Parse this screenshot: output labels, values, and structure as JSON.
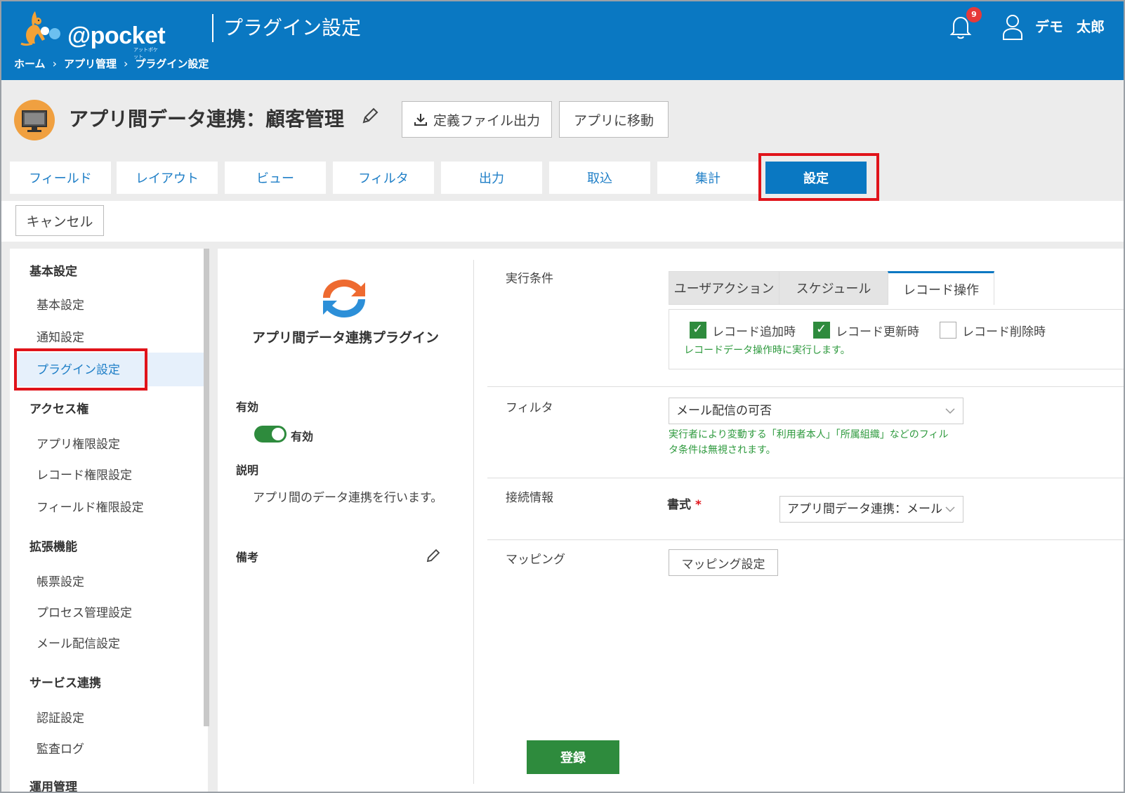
{
  "header": {
    "logo_text": "@pocket",
    "logo_sub": "アットポケット",
    "title": "プラグイン設定",
    "breadcrumb": [
      "ホーム",
      "アプリ管理",
      "プラグイン設定"
    ],
    "breadcrumb_sep": "›",
    "notification_count": "9",
    "user_name": "デモ 太郎"
  },
  "app": {
    "title": "アプリ間データ連携：顧客管理",
    "export_button": "定義ファイル出力",
    "goto_button": "アプリに移動"
  },
  "tabs": [
    {
      "label": "フィールド"
    },
    {
      "label": "レイアウト"
    },
    {
      "label": "ビュー"
    },
    {
      "label": "フィルタ"
    },
    {
      "label": "出力"
    },
    {
      "label": "取込"
    },
    {
      "label": "集計"
    },
    {
      "label": "設定",
      "active": true
    }
  ],
  "cancel_button": "キャンセル",
  "sidebar": {
    "sections": [
      {
        "heading": "基本設定",
        "items": [
          "基本設定",
          "通知設定",
          "プラグイン設定"
        ]
      },
      {
        "heading": "アクセス権",
        "items": [
          "アプリ権限設定",
          "レコード権限設定",
          "フィールド権限設定"
        ]
      },
      {
        "heading": "拡張機能",
        "items": [
          "帳票設定",
          "プロセス管理設定",
          "メール配信設定"
        ]
      },
      {
        "heading": "サービス連携",
        "items": [
          "認証設定",
          "監査ログ"
        ]
      },
      {
        "heading": "運用管理",
        "items": []
      }
    ],
    "active_item": "プラグイン設定"
  },
  "plugin": {
    "name": "アプリ間データ連携プラグイン",
    "enabled_label": "有効",
    "enabled_state": "有効",
    "enabled": true,
    "description_label": "説明",
    "description": "アプリ間のデータ連携を行います。",
    "notes_label": "備考"
  },
  "settings": {
    "execution_label": "実行条件",
    "subtabs": [
      "ユーザアクション",
      "スケジュール",
      "レコード操作"
    ],
    "active_subtab": "レコード操作",
    "checkboxes": [
      {
        "label": "レコード追加時",
        "checked": true
      },
      {
        "label": "レコード更新時",
        "checked": true
      },
      {
        "label": "レコード削除時",
        "checked": false
      }
    ],
    "execution_hint": "レコードデータ操作時に実行します。",
    "filter_label": "フィルタ",
    "filter_value": "メール配信の可否",
    "filter_hint_1": "実行者により変動する「利用者本人」「所属組織」などのフィル",
    "filter_hint_2": "タ条件は無視されます。",
    "connection_label": "接続情報",
    "format_label": "書式",
    "format_required": "*",
    "format_value": "アプリ間データ連携：メール",
    "mapping_label": "マッピング",
    "mapping_button": "マッピング設定",
    "register_button": "登録"
  },
  "colors": {
    "header_bg": "#0a78c2",
    "accent_green": "#2e8b3d",
    "highlight_red": "#e0131a"
  }
}
